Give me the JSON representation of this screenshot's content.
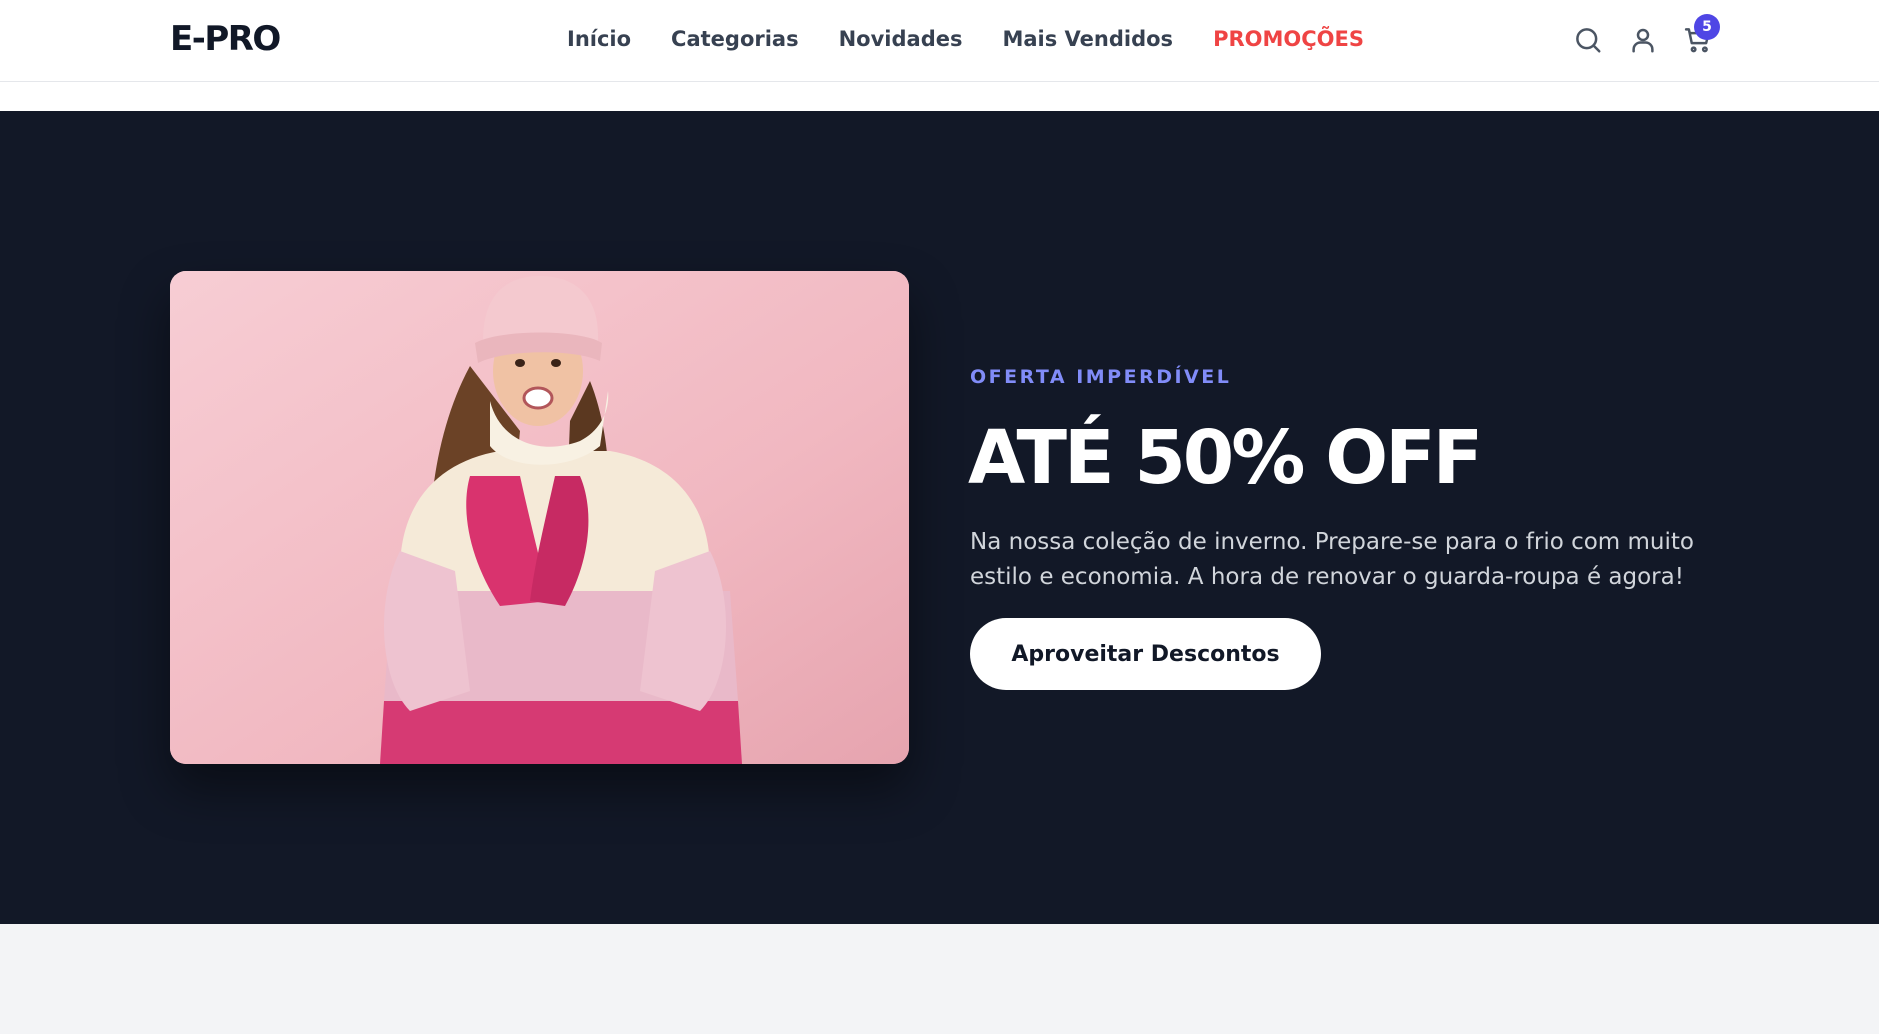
{
  "header": {
    "logo": "E-PRO",
    "nav": [
      {
        "label": "Início"
      },
      {
        "label": "Categorias"
      },
      {
        "label": "Novidades"
      },
      {
        "label": "Mais Vendidos"
      },
      {
        "label": "PROMOÇÕES",
        "highlight": true
      }
    ],
    "icons": [
      "search-icon",
      "user-icon",
      "cart-icon"
    ],
    "cart_count": "5"
  },
  "hero": {
    "eyebrow": "OFERTA IMPERDÍVEL",
    "headline": "ATÉ 50% OFF",
    "description": "Na nossa coleção de inverno. Prepare-se para o frio com muito estilo e economia. A hora de renovar o guarda-roupa é agora!",
    "cta_label": "Aproveitar Descontos"
  },
  "colors": {
    "hero_background": "#121827",
    "accent": "#4f46e5",
    "eyebrow": "#818cf8",
    "promo": "#ef4444",
    "below_background": "#f3f4f6"
  }
}
